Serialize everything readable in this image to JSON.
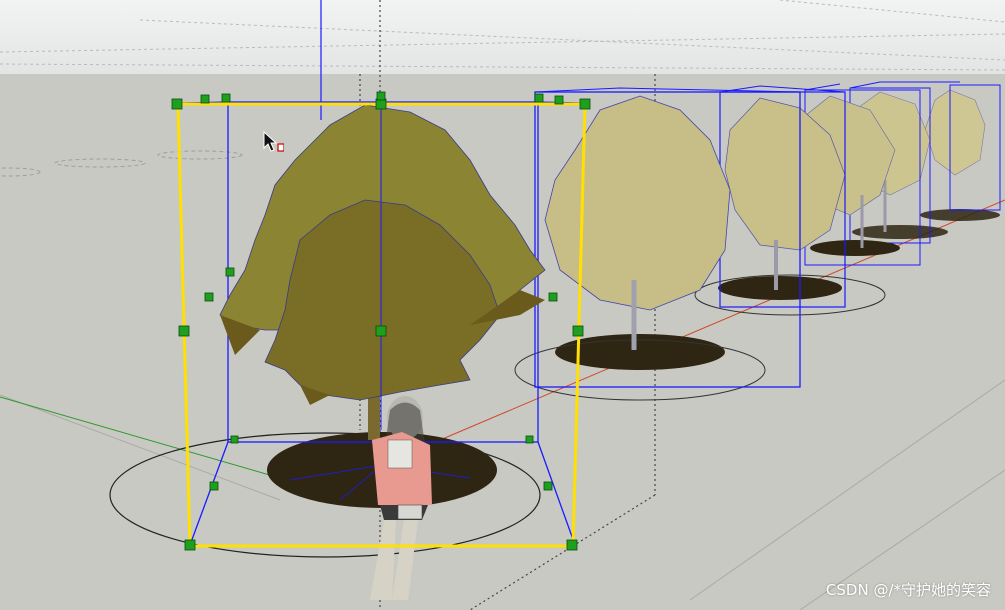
{
  "viewport": {
    "description_free": true,
    "sky_color": "#e9eaea",
    "ground_color": "#c9c9c4",
    "selection_color": "#ffe000",
    "component_edge_color": "#1a1aff",
    "grip_color": "#1a9a1a",
    "foliage_front_color": "#8a8433",
    "foliage_back_color": "#c9c08a",
    "trunk_color": "#7a6a30",
    "shadow_color": "#2e2612"
  },
  "cursor": {
    "icon": "select-arrow-icon"
  },
  "watermark": {
    "text": "CSDN @/*守护她的笑容"
  }
}
